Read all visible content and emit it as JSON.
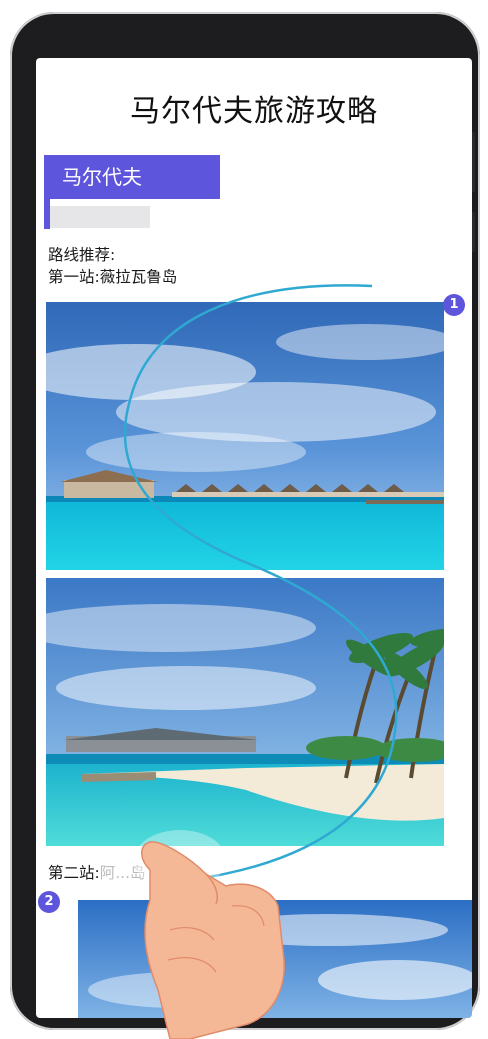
{
  "article": {
    "title": "马尔代夫旅游攻略",
    "tag": "马尔代夫",
    "route_heading": "路线推荐:",
    "stop1": "第一站:薇拉瓦鲁岛",
    "stop2": "第二站:",
    "stop2_obscured": "阿...岛"
  },
  "badges": {
    "first": "1",
    "second": "2"
  },
  "icons": [
    "hand-gesture-icon",
    "s-stroke-gesture"
  ],
  "colors": {
    "accent": "#5d55db",
    "gesture": "#2fa9d2",
    "phone_frame": "#1d1d1f"
  }
}
